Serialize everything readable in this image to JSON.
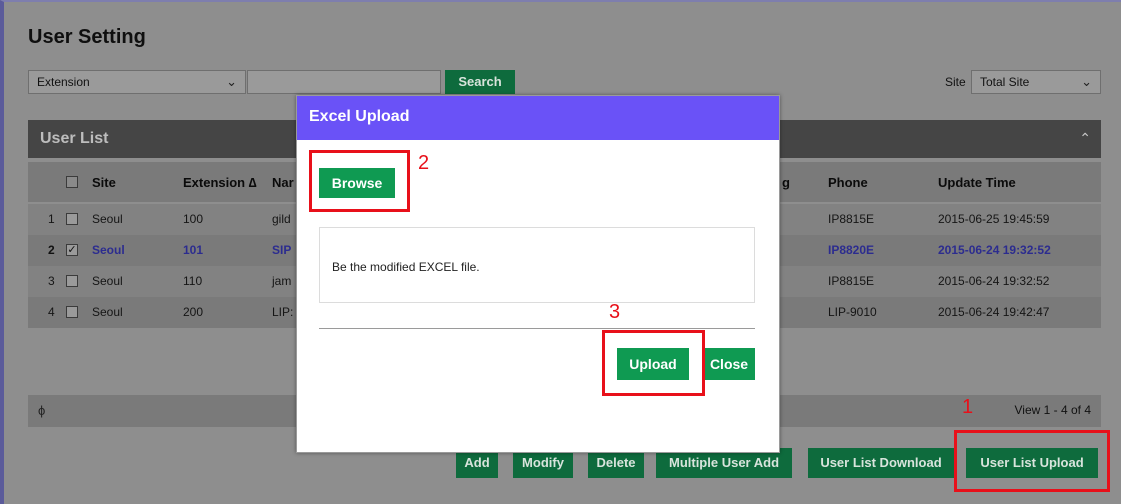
{
  "page": {
    "title": "User Setting"
  },
  "search": {
    "field_value": "Extension",
    "input_value": "",
    "button_label": "Search",
    "site_label": "Site",
    "site_value": "Total Site"
  },
  "user_list": {
    "title": "User List",
    "columns": [
      "Site",
      "Extension ∆",
      "Nar",
      "g",
      "Phone",
      "Update Time"
    ],
    "rows": [
      {
        "num": "1",
        "site": "Seoul",
        "extension": "100",
        "name": "gild",
        "phone": "IP8815E",
        "update_time": "2015-06-25 19:45:59",
        "checked": ""
      },
      {
        "num": "2",
        "site": "Seoul",
        "extension": "101",
        "name": "SIP",
        "phone": "IP8820E",
        "update_time": "2015-06-24 19:32:52",
        "checked": "✓"
      },
      {
        "num": "3",
        "site": "Seoul",
        "extension": "110",
        "name": "jam",
        "phone": "IP8815E",
        "update_time": "2015-06-24 19:32:52",
        "checked": ""
      },
      {
        "num": "4",
        "site": "Seoul",
        "extension": "200",
        "name": "LIP:",
        "phone": "LIP-9010",
        "update_time": "2015-06-24 19:42:47",
        "checked": ""
      }
    ],
    "refresh_icon": "ϕ",
    "pager": "View 1 - 4 of 4"
  },
  "actions": {
    "add": "Add",
    "modify": "Modify",
    "delete": "Delete",
    "multiple_add": "Multiple User Add",
    "download": "User List Download",
    "upload": "User List Upload"
  },
  "annotations": {
    "n1": "1",
    "n2": "2",
    "n3": "3"
  },
  "modal": {
    "title": "Excel Upload",
    "browse_label": "Browse",
    "message": "Be the modified EXCEL file.",
    "upload_label": "Upload",
    "close_label": "Close"
  },
  "colors": {
    "modal_header": "#6a52f7",
    "button_green": "#0f9a52",
    "annotation_red": "#e8101a"
  }
}
